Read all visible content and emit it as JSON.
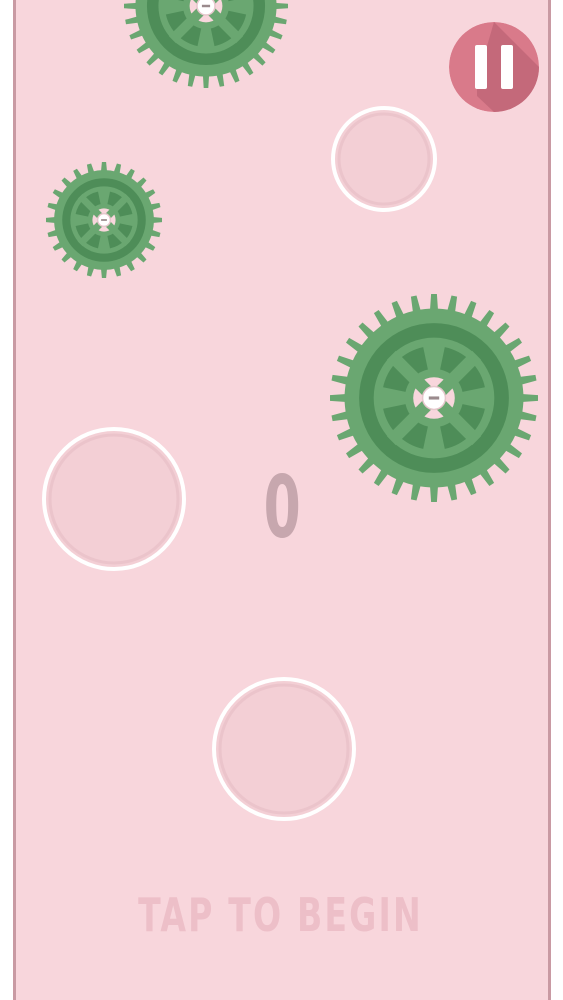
{
  "game": {
    "score": "0",
    "prompt": "TAP TO BEGIN",
    "pause_icon": "pause-icon"
  },
  "colors": {
    "background": "#f8d6dc",
    "border": "#c99aa3",
    "gear_green": "#6aa771",
    "gear_dark": "#4e8d58",
    "ring_white": "#ffffff",
    "ring_inner": "#f3cfd5",
    "score_text": "#c7a7ae",
    "prompt_text": "#edbfc8",
    "pause_button": "#d97a8a",
    "pause_shadow": "#c4697a"
  }
}
